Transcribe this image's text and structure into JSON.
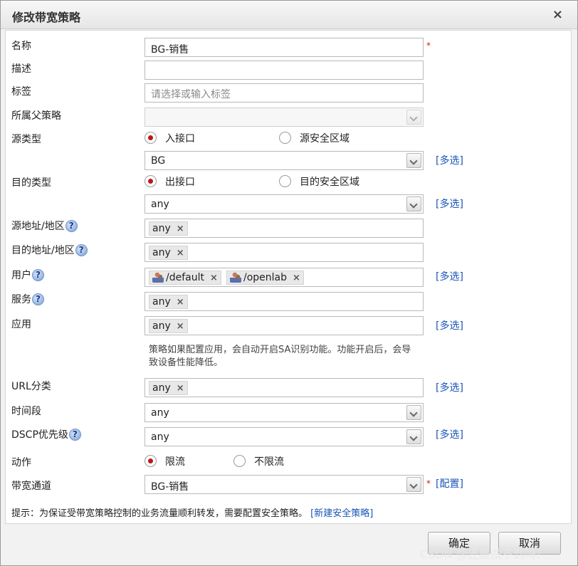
{
  "dialog": {
    "title": "修改带宽策略",
    "close": "×"
  },
  "fields": {
    "name": {
      "label": "名称",
      "value": "BG-销售",
      "required": "*"
    },
    "desc": {
      "label": "描述",
      "value": ""
    },
    "tags": {
      "label": "标签",
      "placeholder": "请选择或输入标签"
    },
    "parent": {
      "label": "所属父策略",
      "value": ""
    },
    "src_type": {
      "label": "源类型",
      "opt1": "入接口",
      "opt2": "源安全区域",
      "selected": "入接口"
    },
    "src_iface": {
      "value": "BG",
      "link": "[多选]"
    },
    "dst_type": {
      "label": "目的类型",
      "opt1": "出接口",
      "opt2": "目的安全区域",
      "selected": "出接口"
    },
    "dst_iface": {
      "value": "any",
      "link": "[多选]"
    },
    "src_addr": {
      "label": "源地址/地区",
      "tag": "any"
    },
    "dst_addr": {
      "label": "目的地址/地区",
      "tag": "any"
    },
    "user": {
      "label": "用户",
      "tags": [
        "/default",
        "/openlab"
      ],
      "link": "[多选]"
    },
    "service": {
      "label": "服务",
      "tag": "any"
    },
    "app": {
      "label": "应用",
      "tag": "any",
      "link": "[多选]",
      "note": "策略如果配置应用，会自动开启SA识别功能。功能开启后，会导致设备性能降低。"
    },
    "url": {
      "label": "URL分类",
      "tag": "any",
      "link": "[多选]"
    },
    "time": {
      "label": "时间段",
      "value": "any"
    },
    "dscp": {
      "label": "DSCP优先级",
      "value": "any",
      "link": "[多选]"
    },
    "action": {
      "label": "动作",
      "opt1": "限流",
      "opt2": "不限流",
      "selected": "限流"
    },
    "channel": {
      "label": "带宽通道",
      "value": "BG-销售",
      "required": "*",
      "link": "[配置]"
    }
  },
  "help_icon": "?",
  "tag_remove": "×",
  "hint": {
    "text": "提示：为保证受带宽策略控制的业务流量顺利转发，需要配置安全策略。",
    "link": "[新建安全策略]"
  },
  "buttons": {
    "ok": "确定",
    "cancel": "取消"
  },
  "watermark": "CSDN @还是做不到吗？",
  "colors": {
    "accent_link": "#1a55b8",
    "radio_selected": "#c0151b",
    "required": "#d02020"
  }
}
